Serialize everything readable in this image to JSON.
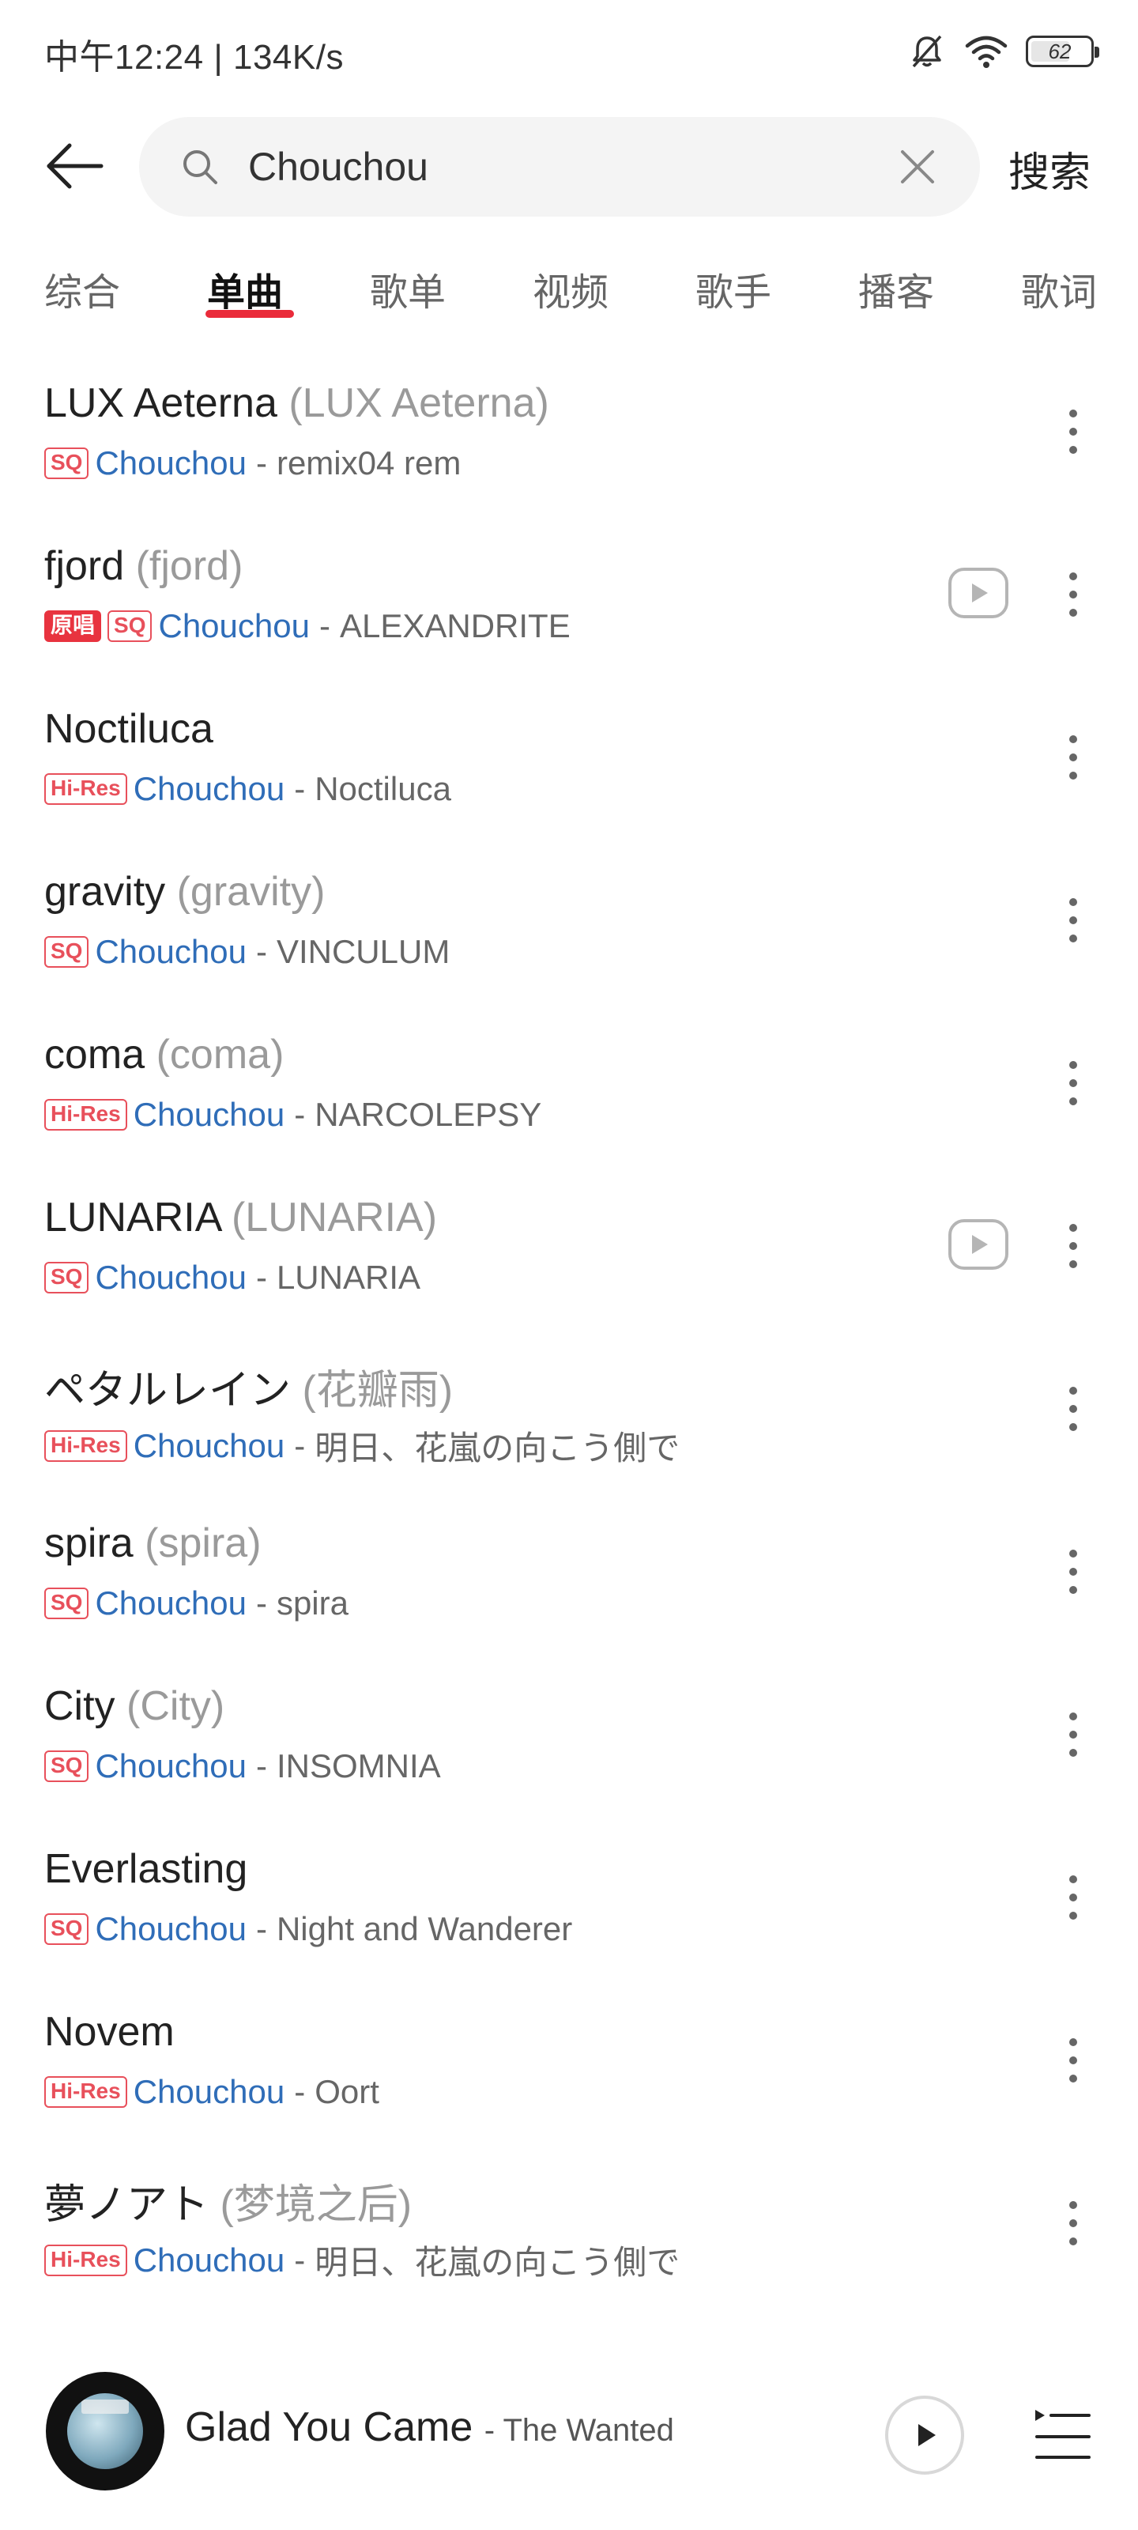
{
  "status_bar": {
    "time": "中午12:24 | 134K/s",
    "icons": [
      "bell-mute-icon",
      "wifi-icon",
      "battery-icon"
    ],
    "battery_level": "62"
  },
  "search": {
    "query": "Chouchou",
    "search_label": "搜索"
  },
  "tabs": [
    {
      "label": "综合",
      "active": false
    },
    {
      "label": "单曲",
      "active": true
    },
    {
      "label": "歌单",
      "active": false
    },
    {
      "label": "视频",
      "active": false
    },
    {
      "label": "歌手",
      "active": false
    },
    {
      "label": "播客",
      "active": false
    },
    {
      "label": "歌词",
      "active": false
    }
  ],
  "songs": [
    {
      "title": "LUX Aeterna",
      "alias": "(LUX Aeterna)",
      "badges": [
        "SQ"
      ],
      "artist": "Chouchou",
      "album": "remix04 rem",
      "has_mv": false
    },
    {
      "title": "fjord",
      "alias": "(fjord)",
      "badges": [
        "原唱",
        "SQ"
      ],
      "artist": "Chouchou",
      "album": "ALEXANDRITE",
      "has_mv": true
    },
    {
      "title": "Noctiluca",
      "alias": "",
      "badges": [
        "Hi-Res"
      ],
      "artist": "Chouchou",
      "album": "Noctiluca",
      "has_mv": false
    },
    {
      "title": "gravity",
      "alias": "(gravity)",
      "badges": [
        "SQ"
      ],
      "artist": "Chouchou",
      "album": "VINCULUM",
      "has_mv": false
    },
    {
      "title": "coma",
      "alias": "(coma)",
      "badges": [
        "Hi-Res"
      ],
      "artist": "Chouchou",
      "album": "NARCOLEPSY",
      "has_mv": false
    },
    {
      "title": "LUNARIA",
      "alias": "(LUNARIA)",
      "badges": [
        "SQ"
      ],
      "artist": "Chouchou",
      "album": "LUNARIA",
      "has_mv": true
    },
    {
      "title": "ペタルレイン",
      "alias": "(花瓣雨)",
      "badges": [
        "Hi-Res"
      ],
      "artist": "Chouchou",
      "album": "明日、花嵐の向こう側で",
      "has_mv": false
    },
    {
      "title": "spira",
      "alias": "(spira)",
      "badges": [
        "SQ"
      ],
      "artist": "Chouchou",
      "album": "spira",
      "has_mv": false
    },
    {
      "title": "City",
      "alias": "(City)",
      "badges": [
        "SQ"
      ],
      "artist": "Chouchou",
      "album": "INSOMNIA",
      "has_mv": false
    },
    {
      "title": "Everlasting",
      "alias": "",
      "badges": [
        "SQ"
      ],
      "artist": "Chouchou",
      "album": "Night and Wanderer",
      "has_mv": false
    },
    {
      "title": "Novem",
      "alias": "",
      "badges": [
        "Hi-Res"
      ],
      "artist": "Chouchou",
      "album": "Oort",
      "has_mv": false
    },
    {
      "title": "夢ノアト",
      "alias": "(梦境之后)",
      "badges": [
        "Hi-Res"
      ],
      "artist": "Chouchou",
      "album": "明日、花嵐の向こう側で",
      "has_mv": false
    }
  ],
  "album_separator": "-",
  "now_playing": {
    "title": "Glad You Came",
    "separator": "-",
    "artist": "The Wanted"
  },
  "colors": {
    "accent_red": "#ea2b3a",
    "artist_blue": "#2f6db8"
  }
}
